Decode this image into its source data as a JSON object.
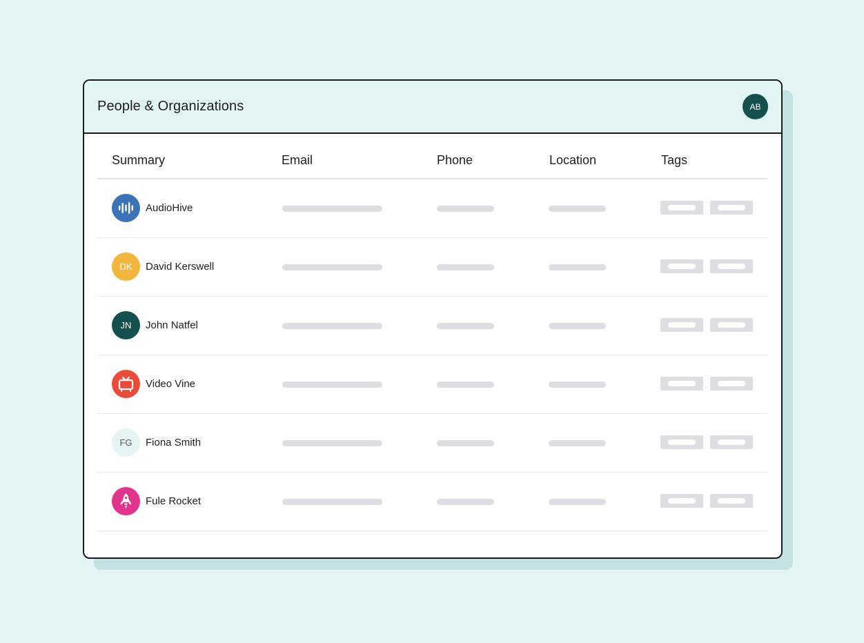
{
  "window": {
    "title": "People & Organizations"
  },
  "user": {
    "initials": "AB"
  },
  "columns": [
    "Summary",
    "Email",
    "Phone",
    "Location",
    "Tags"
  ],
  "rows": [
    {
      "name": "AudioHive",
      "avatar_type": "icon",
      "icon": "audio-wave-icon",
      "color": "#3b73b8"
    },
    {
      "name": "David Kerswell",
      "avatar_type": "initials",
      "initials": "DK",
      "color": "#f1b63b",
      "text_color": "#ffffff"
    },
    {
      "name": "John Natfel",
      "avatar_type": "initials",
      "initials": "JN",
      "color": "#15504d",
      "text_color": "#ffffff"
    },
    {
      "name": "Video Vine",
      "avatar_type": "icon",
      "icon": "tv-icon",
      "color": "#ea4c39"
    },
    {
      "name": "Fiona Smith",
      "avatar_type": "initials",
      "initials": "FG",
      "color": "#e6f4f4",
      "text_color": "#4c5c5c"
    },
    {
      "name": "Fule Rocket",
      "avatar_type": "icon",
      "icon": "rocket-icon",
      "color": "#e0358a"
    }
  ]
}
